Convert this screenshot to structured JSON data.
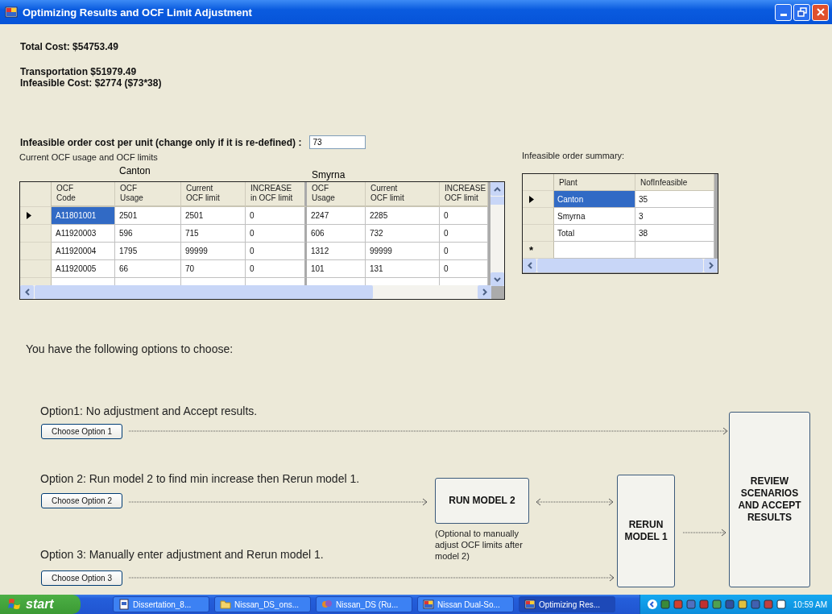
{
  "window": {
    "title": "Optimizing Results and OCF Limit Adjustment"
  },
  "totals": {
    "total_cost": "Total Cost: $54753.49",
    "transportation": "Transportation $51979.49",
    "infeasible_cost": "Infeasible Cost: $2774 ($73*38)"
  },
  "cost_field": {
    "label": "Infeasible order cost per unit (change only if it is re-defined) :",
    "value": "73"
  },
  "ocf_table": {
    "caption": "Current OCF usage and OCF limits",
    "groups": [
      "Canton",
      "Smyrna"
    ],
    "columns": [
      "OCF\nCode",
      "OCF\nUsage",
      "Current\nOCF limit",
      "INCREASE\nin OCF limit",
      "OCF\nUsage",
      "Current\nOCF limit",
      "INCREASE\nOCF limit"
    ],
    "rows": [
      {
        "selected": true,
        "cells": [
          "A11801001",
          "2501",
          "2501",
          "0",
          "2247",
          "2285",
          "0"
        ]
      },
      {
        "selected": false,
        "cells": [
          "A11920003",
          "596",
          "715",
          "0",
          "606",
          "732",
          "0"
        ]
      },
      {
        "selected": false,
        "cells": [
          "A11920004",
          "1795",
          "99999",
          "0",
          "1312",
          "99999",
          "0"
        ]
      },
      {
        "selected": false,
        "cells": [
          "A11920005",
          "66",
          "70",
          "0",
          "101",
          "131",
          "0"
        ]
      }
    ]
  },
  "summary": {
    "caption": "Infeasible order summary:",
    "columns": [
      "Plant",
      "NofInfeasible"
    ],
    "rows": [
      {
        "selected": true,
        "cells": [
          "Canton",
          "35"
        ]
      },
      {
        "selected": false,
        "cells": [
          "Smyrna",
          "3"
        ]
      },
      {
        "selected": false,
        "cells": [
          "Total",
          "38"
        ]
      }
    ],
    "new_row_marker": "*"
  },
  "prompt": "You have the following options to choose:",
  "options": [
    {
      "text": "Option1: No adjustment and Accept results.",
      "button": "Choose Option 1"
    },
    {
      "text": "Option 2: Run model 2 to find  min increase then Rerun model 1.",
      "button": "Choose Option 2"
    },
    {
      "text": "Option 3: Manually enter adjustment and Rerun model 1.",
      "button": "Choose Option 3"
    }
  ],
  "flow": {
    "run_model_2": "RUN MODEL 2",
    "run_model_2_note": "(Optional to manually adjust OCF limits after model 2)",
    "rerun_model_1": "RERUN MODEL 1",
    "review": "REVIEW SCENARIOS AND ACCEPT RESULTS"
  },
  "taskbar": {
    "start": "start",
    "tasks": [
      {
        "label": "Dissertation_8...",
        "kind": "document",
        "selected": false
      },
      {
        "label": "Nissan_DS_ons...",
        "kind": "folder",
        "selected": false
      },
      {
        "label": "Nissan_DS (Ru...",
        "kind": "tool",
        "selected": false
      },
      {
        "label": "Nissan Dual-So...",
        "kind": "app",
        "selected": false
      },
      {
        "label": "Optimizing Res...",
        "kind": "app",
        "selected": true
      }
    ],
    "clock": "10:59 AM"
  }
}
